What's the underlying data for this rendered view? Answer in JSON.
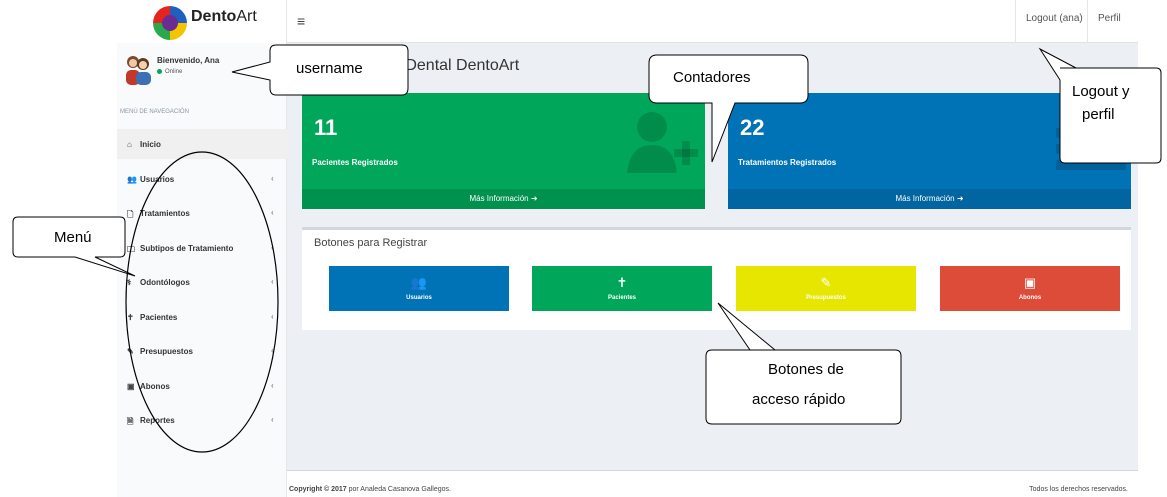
{
  "brand": {
    "name_bold": "Dento",
    "name_thin": "Art"
  },
  "topbar": {
    "menu_icon": "≡",
    "logout": "Logout (ana)",
    "profile": "Perfil"
  },
  "user": {
    "name": "Bienvenido, Ana",
    "status": "Online"
  },
  "nav": {
    "header": "MENÚ DE NAVEGACIÓN",
    "items": [
      {
        "label": "Inicio",
        "icon": "home-icon",
        "glyph": "⌂",
        "active": true,
        "chevron": ""
      },
      {
        "label": "Usuarios",
        "icon": "users-icon",
        "glyph": "👥",
        "active": false,
        "chevron": "‹"
      },
      {
        "label": "Tratamientos",
        "icon": "file-icon",
        "glyph": "🗋",
        "active": false,
        "chevron": "‹"
      },
      {
        "label": "Subtipos de Tratamiento",
        "icon": "folder-icon",
        "glyph": "🗀",
        "active": false,
        "chevron": "‹"
      },
      {
        "label": "Odontólogos",
        "icon": "doctor-icon",
        "glyph": "⚕",
        "active": false,
        "chevron": "‹"
      },
      {
        "label": "Pacientes",
        "icon": "patient-icon",
        "glyph": "✝",
        "active": false,
        "chevron": "‹"
      },
      {
        "label": "Presupuestos",
        "icon": "budget-icon",
        "glyph": "✎",
        "active": false,
        "chevron": "‹"
      },
      {
        "label": "Abonos",
        "icon": "money-icon",
        "glyph": "▣",
        "active": false,
        "chevron": "‹"
      },
      {
        "label": "Reportes",
        "icon": "report-icon",
        "glyph": "🗎",
        "active": false,
        "chevron": "‹"
      }
    ]
  },
  "page": {
    "title": "a Dental DentoArt"
  },
  "counters": [
    {
      "value": "11",
      "label": "Pacientes Registrados",
      "footer": "Más Información ➜",
      "color": "#00a65a"
    },
    {
      "value": "22",
      "label": "Tratamientos Registrados",
      "footer": "Más Información ➜",
      "color": "#0073b7"
    }
  ],
  "quick": {
    "title": "Botones para Registrar",
    "buttons": [
      {
        "label": "Usuarios",
        "icon": "users-icon",
        "glyph": "👥",
        "color": "#0073b7"
      },
      {
        "label": "Pacientes",
        "icon": "patient-icon",
        "glyph": "✝",
        "color": "#00a65a"
      },
      {
        "label": "Presupuestos",
        "icon": "budget-icon",
        "glyph": "✎",
        "color": "#e6e600"
      },
      {
        "label": "Abonos",
        "icon": "money-icon",
        "glyph": "▣",
        "color": "#dd4b39"
      }
    ]
  },
  "footer": {
    "copyright_bold": "Copyright © 2017",
    "copyright_rest": " por Analeda Casanova Gallegos.",
    "rights": "Todos los derechos reservados."
  },
  "annotations": {
    "username": "username",
    "contadores": "Contadores",
    "logout_1": "Logout y",
    "logout_2": "perfil",
    "menu": "Menú",
    "botones_1": "Botones de",
    "botones_2": "acceso rápido"
  }
}
